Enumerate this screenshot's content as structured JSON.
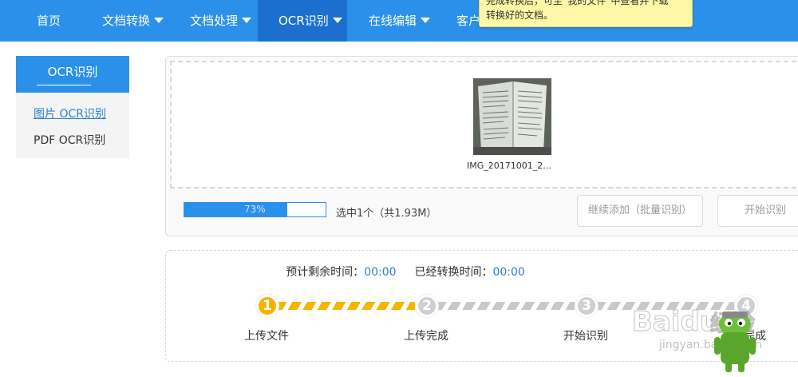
{
  "nav": {
    "items": [
      {
        "label": "首页",
        "dropdown": false
      },
      {
        "label": "文档转换",
        "dropdown": true
      },
      {
        "label": "文档处理",
        "dropdown": true
      },
      {
        "label": "OCR识别",
        "dropdown": true,
        "active": true
      },
      {
        "label": "在线编辑",
        "dropdown": true
      },
      {
        "label": "客户",
        "dropdown": false
      }
    ],
    "color": "#2b90e9",
    "active_color": "#1a6fcf"
  },
  "tooltip": {
    "line1": "完成转换后，可至“我的文件”中查看并下载",
    "line2": "转换好的文档。"
  },
  "sidebar": {
    "title": "OCR识别",
    "items": [
      {
        "label": "图片 OCR识别",
        "active": true
      },
      {
        "label": "PDF OCR识别",
        "active": false
      }
    ]
  },
  "upload": {
    "file_name": "IMG_20171001_2...",
    "progress_percent": 73,
    "progress_label": "73%",
    "selection_text": "选中1个（共1.93M）",
    "add_button": "继续添加（批量识别）",
    "start_button": "开始识别"
  },
  "status": {
    "remaining_label": "预计剩余时间：",
    "remaining_value": "00:00",
    "elapsed_label": "已经转换时间：",
    "elapsed_value": "00:00"
  },
  "steps": [
    {
      "number": "1",
      "label": "上传文件",
      "done": true
    },
    {
      "number": "2",
      "label": "上传完成",
      "done": false
    },
    {
      "number": "3",
      "label": "开始识别",
      "done": false
    },
    {
      "number": "4",
      "label": "完成",
      "done": false
    }
  ],
  "watermark": {
    "text": "Baidu经验",
    "url_text": "jingyan.baidu.com"
  },
  "colors": {
    "accent": "#2b90e9",
    "step_active": "#f5b400",
    "step_inactive": "#cfcfcf",
    "link": "#2b7fd6"
  }
}
